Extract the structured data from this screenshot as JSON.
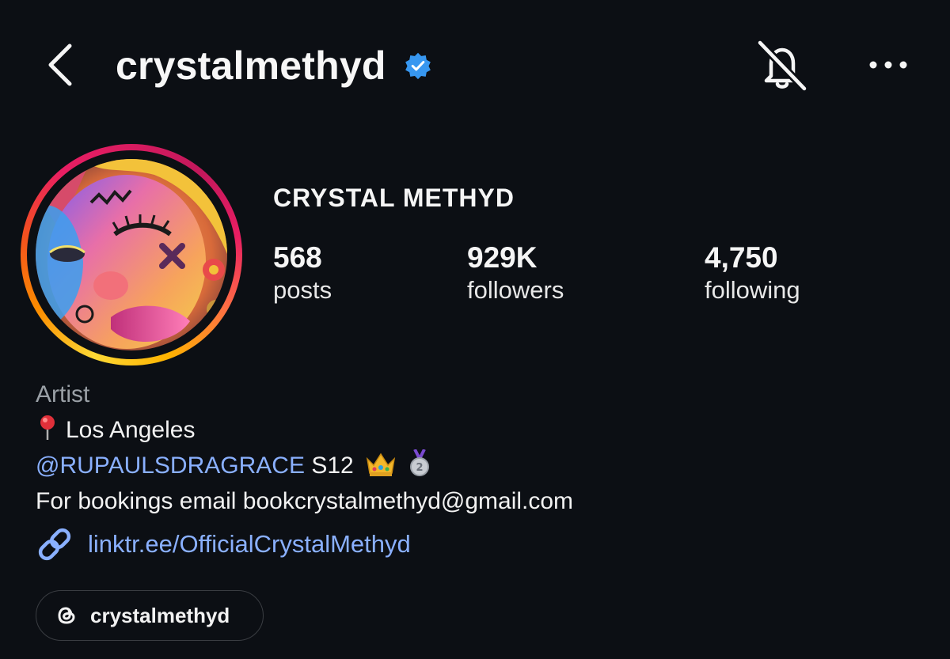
{
  "header": {
    "username": "crystalmethyd",
    "verified": true,
    "icons": [
      "back-arrow-icon",
      "verified-badge-icon",
      "bell-off-icon",
      "more-options-icon"
    ]
  },
  "profile": {
    "display_name": "CRYSTAL METHYD",
    "stats": {
      "posts": {
        "value": "568",
        "label": "posts"
      },
      "followers": {
        "value": "929K",
        "label": "followers"
      },
      "following": {
        "value": "4,750",
        "label": "following"
      }
    }
  },
  "bio": {
    "category": "Artist",
    "location": "Los Angeles",
    "mention": "@RUPAULSDRAGRACE",
    "mention_suffix": "S12",
    "booking": "For bookings email bookcrystalmethyd@gmail.com",
    "link": "linktr.ee/OfficialCrystalMethyd"
  },
  "threads": {
    "handle": "crystalmethyd"
  },
  "colors": {
    "background": "#0c0f14",
    "link": "#8ab0ff",
    "verified": "#3797f0",
    "category": "#9aa0a6"
  }
}
